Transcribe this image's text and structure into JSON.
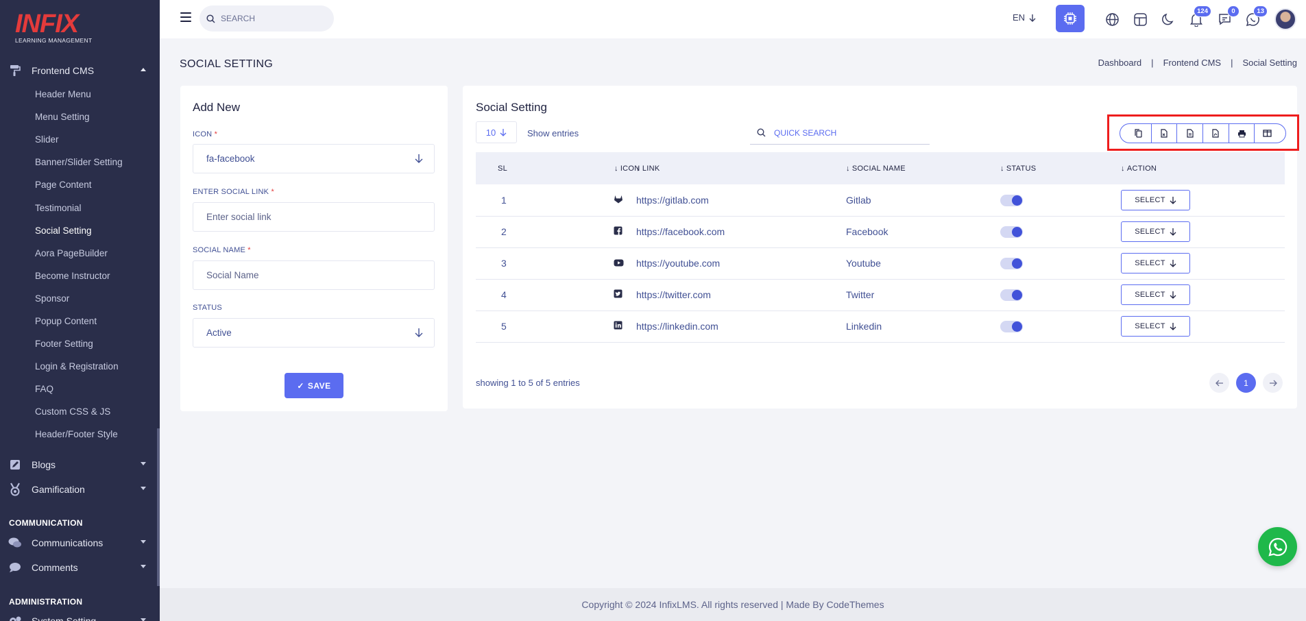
{
  "logo": {
    "main": "INFIX",
    "sub": "LEARNING MANAGEMENT"
  },
  "sidebar": {
    "frontend_cms": {
      "label": "Frontend CMS",
      "icon": "paint-roller-icon"
    },
    "sub_items": [
      "Header Menu",
      "Menu Setting",
      "Slider",
      "Banner/Slider Setting",
      "Page Content",
      "Testimonial",
      "Social Setting",
      "Aora PageBuilder",
      "Become Instructor",
      "Sponsor",
      "Popup Content",
      "Footer Setting",
      "Login & Registration",
      "FAQ",
      "Custom CSS & JS",
      "Header/Footer Style"
    ],
    "active_sub": "Social Setting",
    "blogs": {
      "label": "Blogs",
      "icon": "edit-icon"
    },
    "gamification": {
      "label": "Gamification",
      "icon": "medal-icon"
    },
    "communication_head": "COMMUNICATION",
    "communications": {
      "label": "Communications",
      "icon": "chat-icon"
    },
    "comments": {
      "label": "Comments",
      "icon": "comment-icon"
    },
    "administration_head": "ADMINISTRATION",
    "system_setting": {
      "label": "System Setting",
      "icon": "gears-icon"
    }
  },
  "topbar": {
    "search_placeholder": "SEARCH",
    "language": "EN",
    "notifications_count": "124",
    "messages_count": "0",
    "chat_count": "13",
    "accent_color": "#5b6cf0"
  },
  "page": {
    "title": "SOCIAL SETTING",
    "breadcrumb": [
      "Dashboard",
      "Frontend CMS",
      "Social Setting"
    ]
  },
  "add_new": {
    "title": "Add New",
    "icon_label": "ICON",
    "icon_value": "fa-facebook",
    "link_label": "ENTER SOCIAL LINK",
    "link_placeholder": "Enter social link",
    "name_label": "SOCIAL NAME",
    "name_placeholder": "Social Name",
    "status_label": "STATUS",
    "status_value": "Active",
    "save_label": "SAVE"
  },
  "table": {
    "title": "Social Setting",
    "page_size": "10",
    "show_entries": "Show entries",
    "quick_search_placeholder": "QUICK SEARCH",
    "export_buttons": [
      "copy-icon",
      "csv-icon",
      "excel-icon",
      "pdf-icon",
      "print-icon",
      "columns-icon"
    ],
    "columns": [
      "SL",
      "ICON",
      "LINK",
      "SOCIAL NAME",
      "STATUS",
      "ACTION"
    ],
    "rows": [
      {
        "sl": "1",
        "icon": "gitlab-icon",
        "link": "https://gitlab.com",
        "name": "Gitlab",
        "status": true,
        "action": "SELECT"
      },
      {
        "sl": "2",
        "icon": "facebook-icon",
        "link": "https://facebook.com",
        "name": "Facebook",
        "status": true,
        "action": "SELECT"
      },
      {
        "sl": "3",
        "icon": "youtube-icon",
        "link": "https://youtube.com",
        "name": "Youtube",
        "status": true,
        "action": "SELECT"
      },
      {
        "sl": "4",
        "icon": "twitter-icon",
        "link": "https://twitter.com",
        "name": "Twitter",
        "status": true,
        "action": "SELECT"
      },
      {
        "sl": "5",
        "icon": "linkedin-icon",
        "link": "https://linkedin.com",
        "name": "Linkedin",
        "status": true,
        "action": "SELECT"
      }
    ],
    "showing": "showing 1 to 5 of 5 entries",
    "current_page": "1"
  },
  "footer": {
    "text": "Copyright © 2024 InfixLMS. All rights reserved | Made By CodeThemes"
  }
}
